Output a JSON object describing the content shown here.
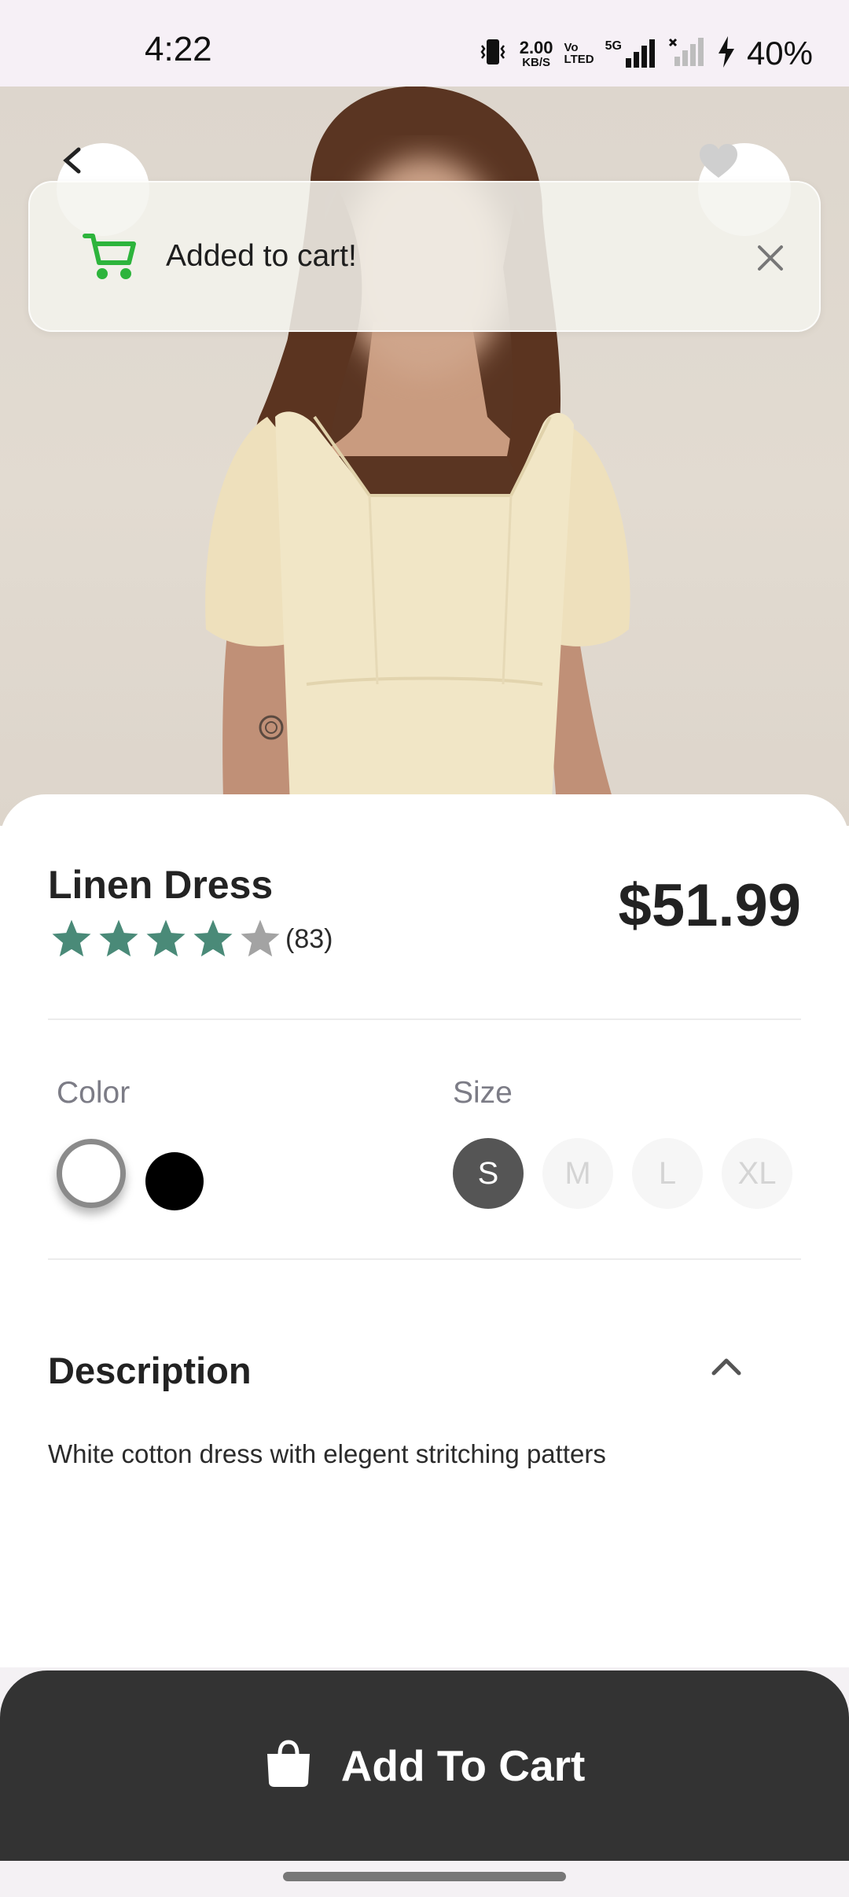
{
  "status_bar": {
    "time": "4:22",
    "net_speed_value": "2.00",
    "net_speed_unit": "KB/S",
    "volte_top": "Vo",
    "volte_bottom": "LTED",
    "network": "5G",
    "battery": "40%"
  },
  "toast": {
    "message": "Added to cart!",
    "icon": "cart-icon",
    "icon_color": "#2db43c"
  },
  "product": {
    "name": "Linen Dress",
    "price": "$51.99",
    "rating_stars": 4,
    "rating_max": 5,
    "rating_count": "(83)",
    "star_color": "#4a8a78"
  },
  "options": {
    "color_label": "Color",
    "colors": [
      "#ffffff",
      "#000000"
    ],
    "selected_color_index": 0,
    "size_label": "Size",
    "sizes": [
      "S",
      "M",
      "L",
      "XL"
    ],
    "selected_size": "S"
  },
  "description": {
    "title": "Description",
    "text": "White cotton dress with elegent stritching patters",
    "expanded": true
  },
  "cta": {
    "label": "Add To Cart",
    "icon": "shopping-bag-icon"
  }
}
